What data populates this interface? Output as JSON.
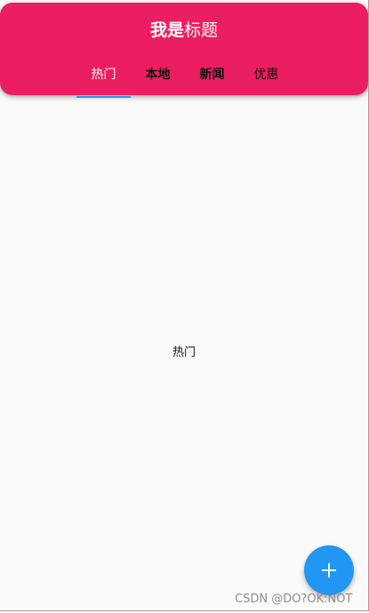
{
  "app_bar": {
    "title_bold": "我是",
    "title_regular": "标题",
    "background": "#ec1e62"
  },
  "tabs": [
    {
      "label": "热门",
      "selected": true
    },
    {
      "label": "本地",
      "selected": false
    },
    {
      "label": "新闻",
      "selected": false
    },
    {
      "label": "优惠",
      "selected": false
    }
  ],
  "tab_indicator_color": "#2196f3",
  "content": {
    "text": "热门"
  },
  "fab": {
    "icon": "plus-icon",
    "color": "#2196f3"
  },
  "watermark": "CSDN @DO?OK:NOT"
}
